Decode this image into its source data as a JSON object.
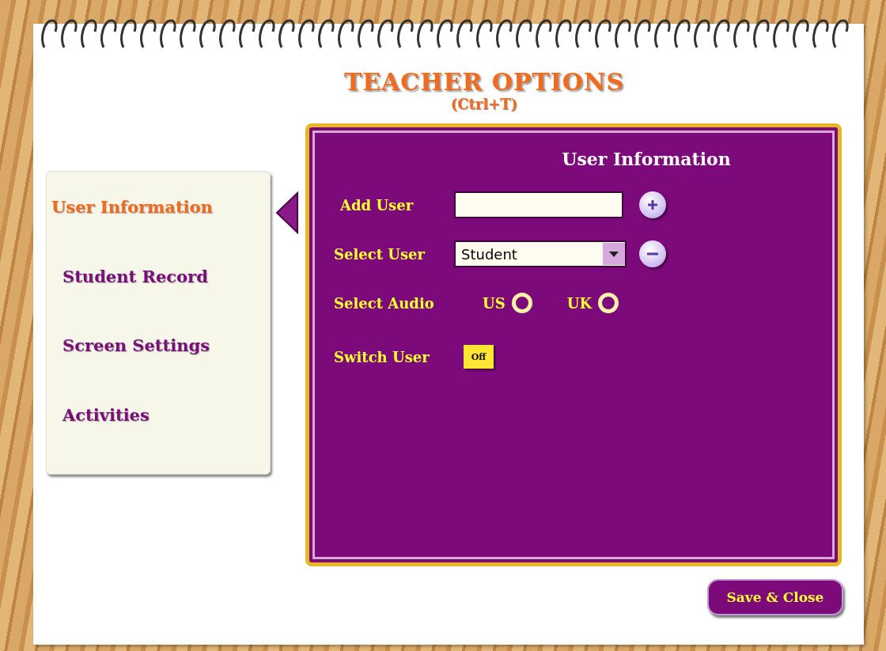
{
  "header": {
    "title": "TEACHER OPTIONS",
    "shortcut": "(Ctrl+T)"
  },
  "sidebar": {
    "items": [
      {
        "label": "User Information",
        "selected": true
      },
      {
        "label": "Student Record",
        "selected": false
      },
      {
        "label": "Screen Settings",
        "selected": false
      },
      {
        "label": "Activities",
        "selected": false
      }
    ]
  },
  "panel": {
    "title": "User Information",
    "add_user": {
      "label": "Add User"
    },
    "select_user": {
      "label": "Select User",
      "value": "Student"
    },
    "select_audio": {
      "label": "Select Audio",
      "options": [
        {
          "label": "US",
          "selected": false
        },
        {
          "label": "UK",
          "selected": false
        }
      ]
    },
    "switch_user": {
      "label": "Switch User",
      "on": false,
      "state_label": "Off"
    }
  },
  "footer": {
    "save_button": "Save & Close"
  }
}
